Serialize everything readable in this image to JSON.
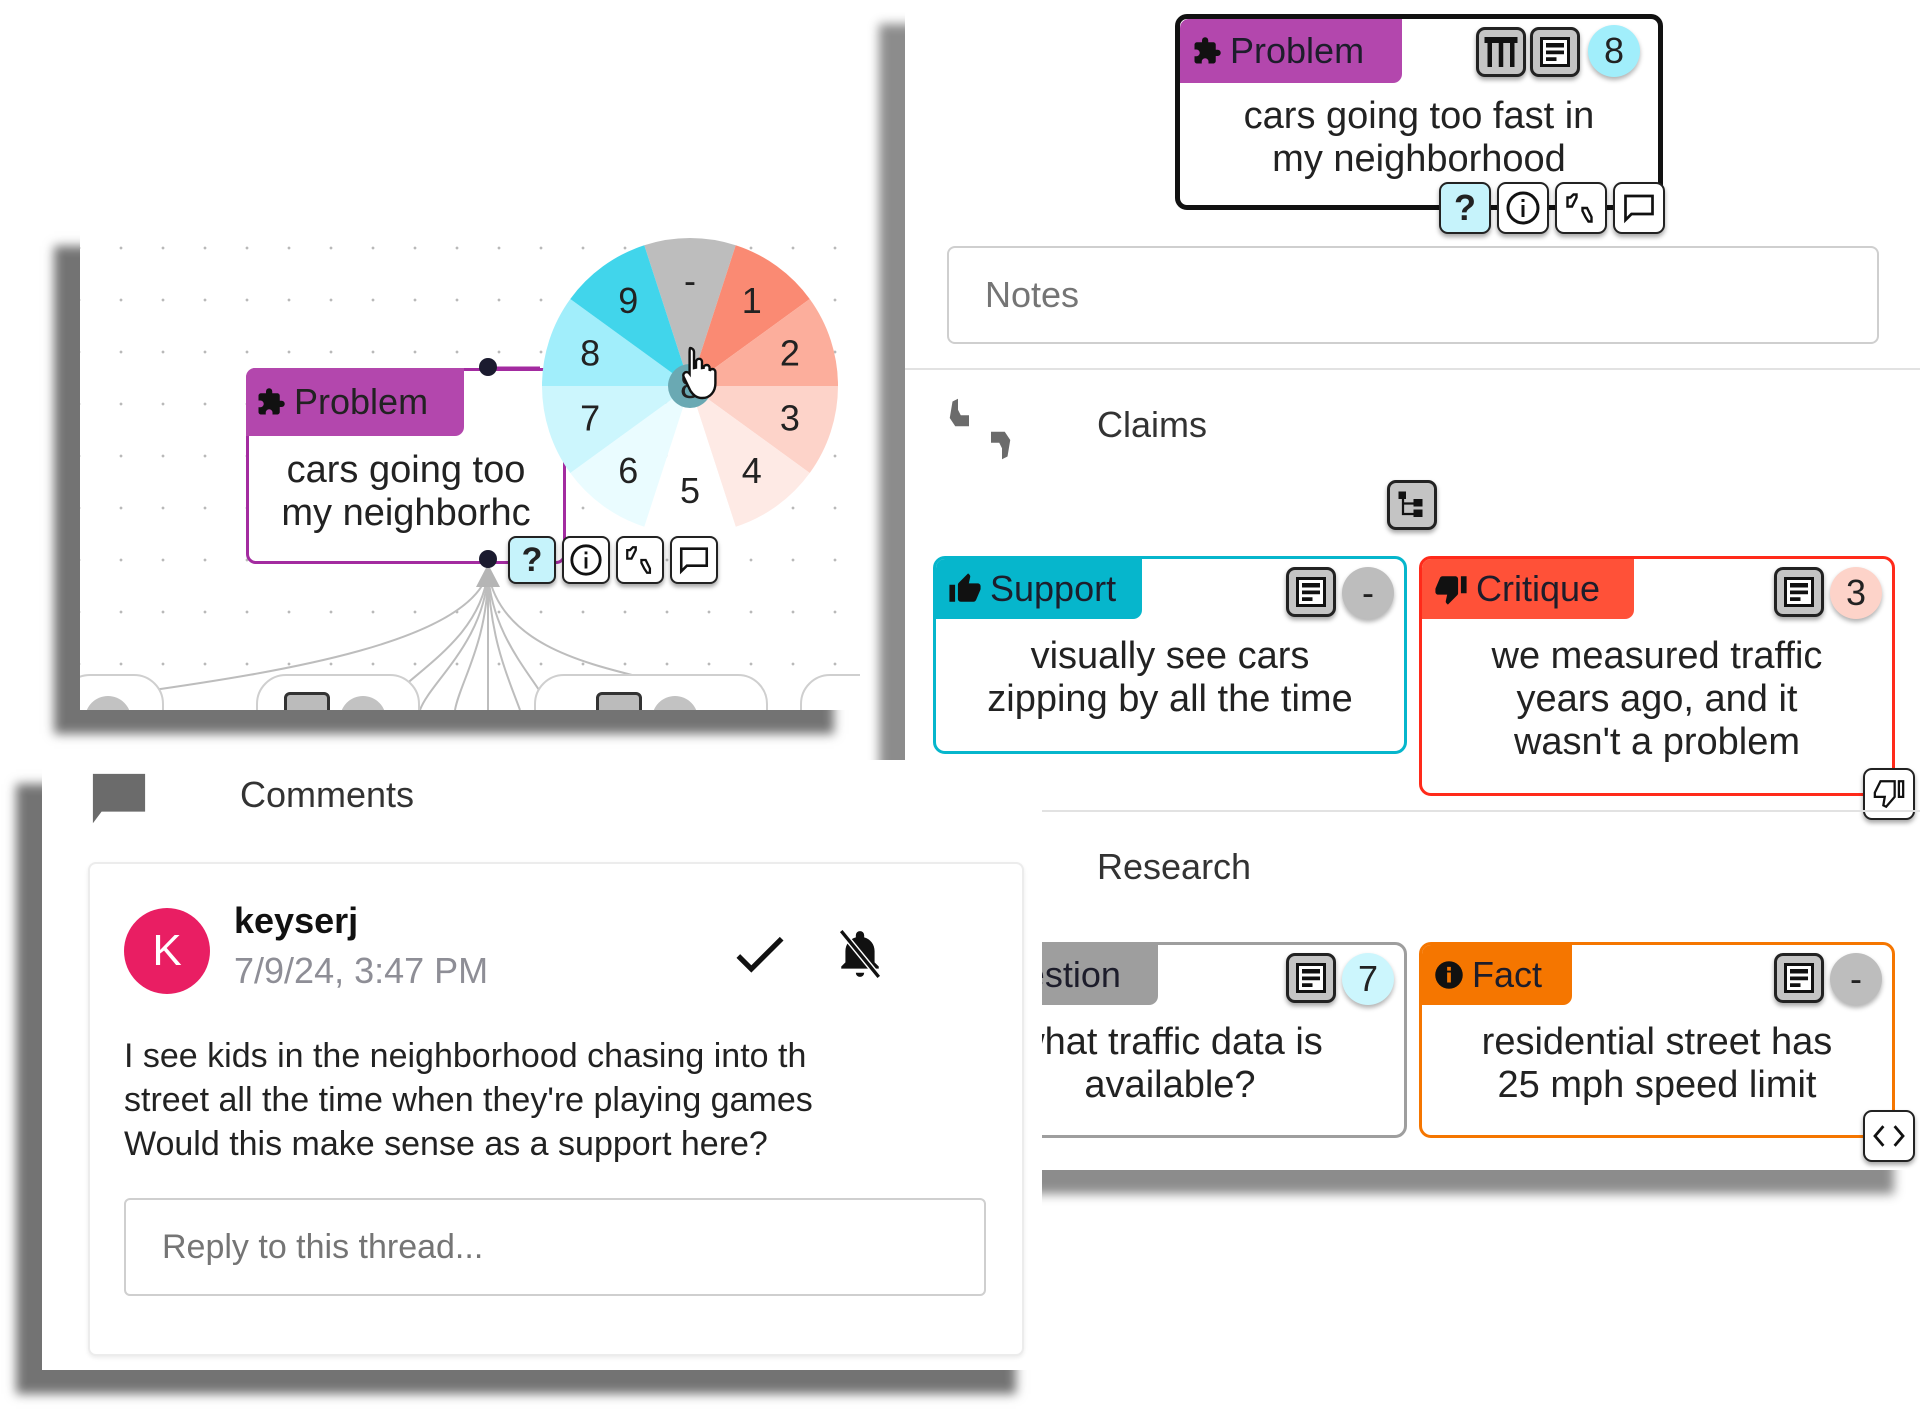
{
  "canvas": {
    "problem_node": {
      "tag": "Problem",
      "text_line1": "cars going too",
      "text_line2": "my neighborhc",
      "action_buttons": [
        {
          "icon": "question-icon",
          "label": "?"
        },
        {
          "icon": "info-icon",
          "label": ""
        },
        {
          "icon": "thumbs-up-down-icon",
          "label": ""
        },
        {
          "icon": "comment-icon",
          "label": ""
        }
      ]
    },
    "score_wheel": {
      "center_value": "8",
      "segments": [
        {
          "label": "-",
          "color": "#bdbdbd"
        },
        {
          "label": "1",
          "color": "#fa8a73"
        },
        {
          "label": "2",
          "color": "#fcae9c"
        },
        {
          "label": "3",
          "color": "#fdd3c9"
        },
        {
          "label": "4",
          "color": "#feeae5"
        },
        {
          "label": "5",
          "color": "#ffffff"
        },
        {
          "label": "6",
          "color": "#eafcff"
        },
        {
          "label": "7",
          "color": "#ccf6fd"
        },
        {
          "label": "8",
          "color": "#a1eefb"
        },
        {
          "label": "9",
          "color": "#41d5eb"
        }
      ]
    }
  },
  "detail": {
    "problem_card": {
      "tag": "Problem",
      "text_line1": "cars going too fast in",
      "text_line2": "my neighborhood",
      "score": "8",
      "action_buttons": [
        {
          "icon": "question-icon",
          "label": "?"
        },
        {
          "icon": "info-icon",
          "label": ""
        },
        {
          "icon": "thumbs-up-down-icon",
          "label": ""
        },
        {
          "icon": "comment-icon",
          "label": ""
        }
      ]
    },
    "notes": {
      "placeholder": "Notes",
      "value": ""
    },
    "claims": {
      "title": "Claims",
      "support": {
        "tag": "Support",
        "text_line1": "visually see cars",
        "text_line2": "zipping by all the time",
        "score": "-"
      },
      "critique": {
        "tag": "Critique",
        "text_line1": "we measured traffic",
        "text_line2": "years ago, and it",
        "text_line3": "wasn't a problem",
        "score": "3"
      }
    },
    "research": {
      "title": "Research",
      "question": {
        "tag": "Question",
        "text_line1": "what traffic data is",
        "text_line2": "available?",
        "score": "7"
      },
      "fact": {
        "tag": "Fact",
        "text_line1": "residential street has",
        "text_line2": "25 mph speed limit",
        "score": "-"
      }
    }
  },
  "comments": {
    "title": "Comments",
    "thread": {
      "avatar_letter": "K",
      "author": "keyserj",
      "timestamp": "7/9/24, 3:47 PM",
      "body_line1": "I see kids in the neighborhood chasing into th",
      "body_line2": "street all the time when they're playing games",
      "body_line3": "Would this make sense as a support here?",
      "reply_placeholder": "Reply to this thread..."
    }
  },
  "colors": {
    "problem": "#b347ad",
    "support": "#06b6cc",
    "critique": "#ff5138",
    "question": "#9e9e9e",
    "fact": "#f57600",
    "avatar": "#e91e63"
  }
}
